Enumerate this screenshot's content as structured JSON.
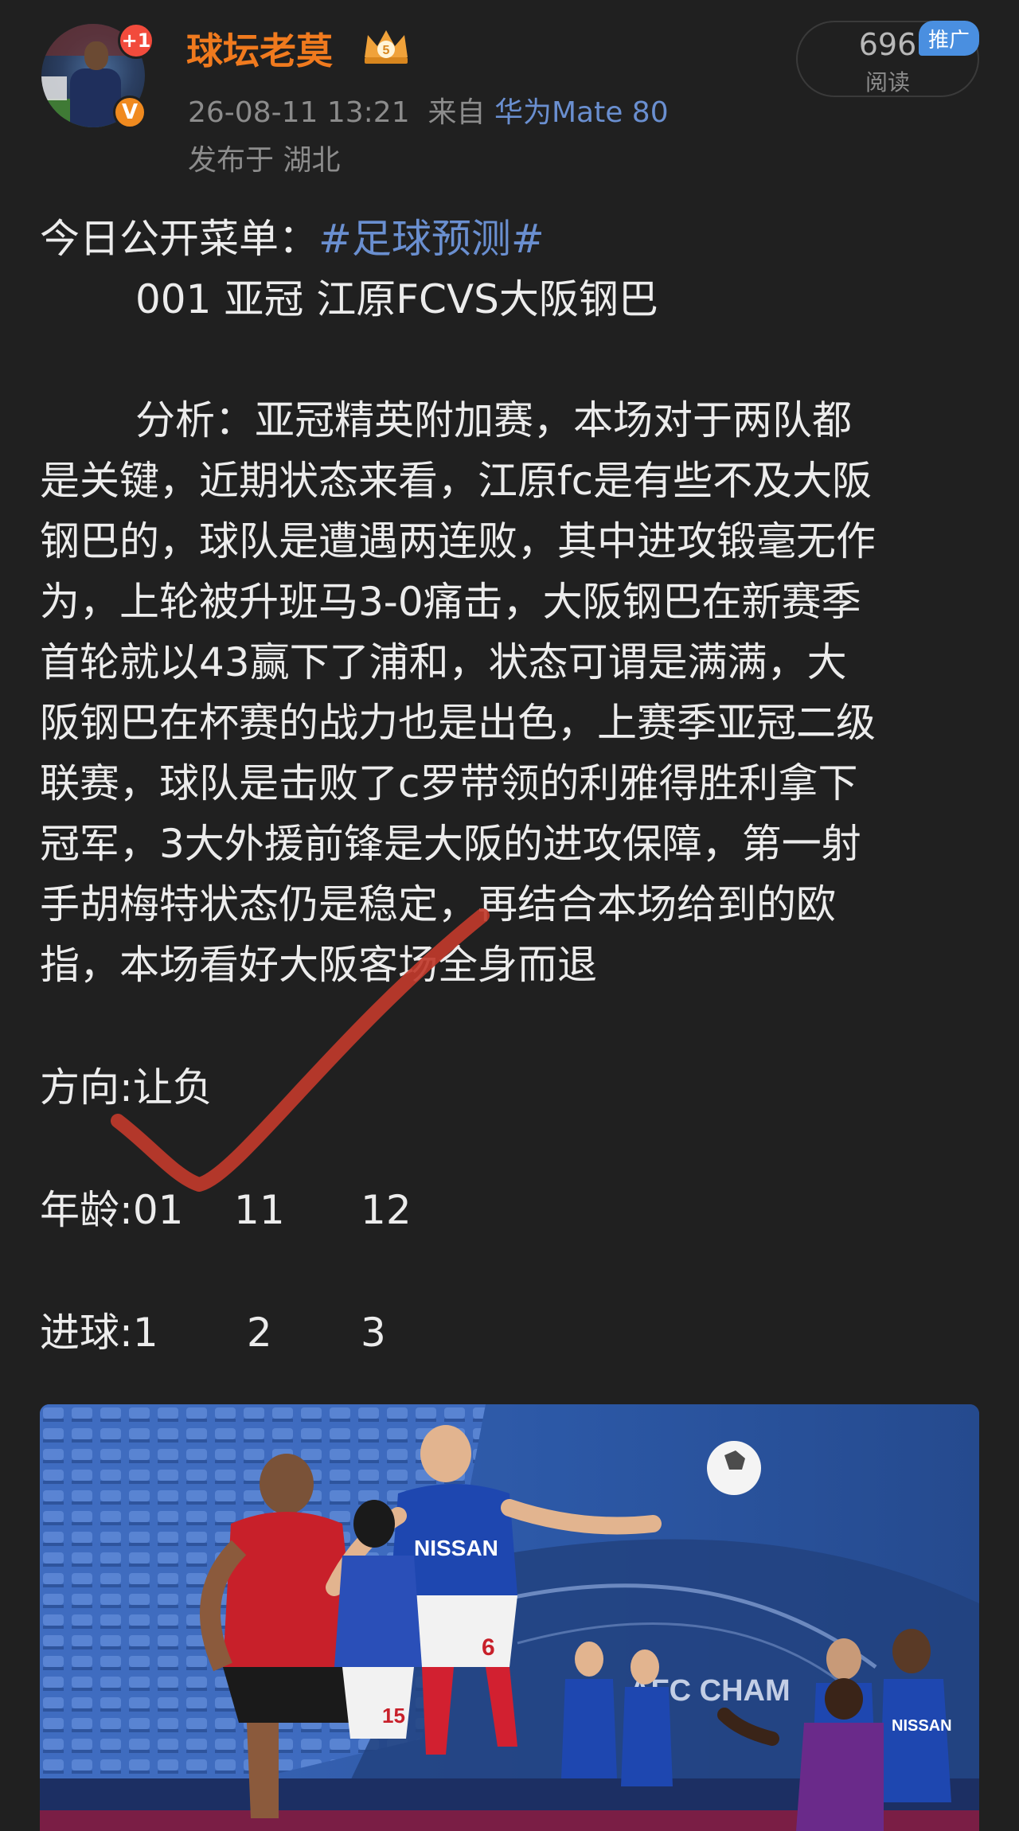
{
  "header": {
    "username": "球坛老莫",
    "notification_badge": "+1",
    "verified_badge": "V",
    "level_badge": "5",
    "timestamp": "26-08-11 13:21",
    "from_label": "来自",
    "device": "华为Mate 80",
    "location": "发布于 湖北",
    "reads_count": "696",
    "reads_label": "阅读",
    "promo_label": "推广"
  },
  "post": {
    "intro_prefix": "今日公开菜单：",
    "hashtag": "#足球预测#",
    "match_line": "001 亚冠 江原FCVS大阪钢巴",
    "analysis_lines": [
      "分析：亚冠精英附加赛，本场对于两队都",
      "是关键，近期状态来看，江原fc是有些不及大阪",
      "钢巴的，球队是遭遇两连败，其中进攻锻毫无作",
      "为，上轮被升班马3-0痛击，大阪钢巴在新赛季",
      "首轮就以43赢下了浦和，状态可谓是满满，大",
      "阪钢巴在杯赛的战力也是出色，上赛季亚冠二级",
      "联赛，球队是击败了c罗带领的利雅得胜利拿下",
      "冠军，3大外援前锋是大阪的进攻保障，第一射",
      "手胡梅特状态仍是稳定，再结合本场给到的欧",
      "指，本场看好大阪客场全身而退"
    ],
    "direction": "方向:让负",
    "age": "年龄:01    11      12",
    "goals": "进球:1       2       3"
  },
  "photo": {
    "jersey_sponsor": "NISSAN",
    "board_text": "AFC CHAM",
    "number_6": "6",
    "number_15": "15"
  },
  "colors": {
    "background": "#202020",
    "username": "#f07a1e",
    "link": "#6a8fd0",
    "tick": "#c0392b"
  }
}
